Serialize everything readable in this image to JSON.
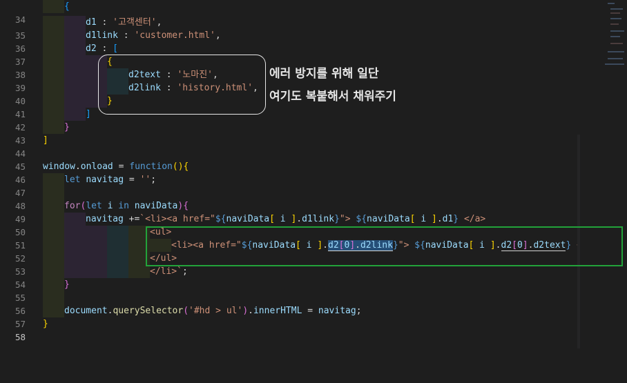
{
  "editor": {
    "line_numbers": [
      "34",
      "35",
      "36",
      "37",
      "38",
      "39",
      "40",
      "41",
      "42",
      "43",
      "44",
      "45",
      "46",
      "47",
      "48",
      "49",
      "50",
      "51",
      "52",
      "53",
      "54",
      "55",
      "56",
      "57",
      "58"
    ],
    "active_line": "58",
    "code": {
      "l35_d1_key": "d1",
      "l35_d1_val": "'고객센터'",
      "l36_d1link_key": "d1link",
      "l36_d1link_val": "'customer.html'",
      "l37_d2_key": "d2",
      "l39_d2text_key": "d2text",
      "l39_d2text_val": "'노마진'",
      "l40_d2link_key": "d2link",
      "l40_d2link_val": "'history.html'",
      "l46_window": "window",
      "l46_onload": "onload",
      "l46_function": "function",
      "l47_let": "let",
      "l47_navitag": "navitag",
      "l47_val": "''",
      "l49_for": "for",
      "l49_let": "let",
      "l49_i": "i",
      "l49_in": "in",
      "l49_navidata": "naviData",
      "l50_navitag": "navitag",
      "l57_document": "document",
      "l57_qs": "querySelector",
      "l57_arg": "'#hd > ul'",
      "l57_inner": "innerHTML",
      "l57_navitag": "navitag"
    }
  },
  "annotation": {
    "line1": "에러 방지를 위해 일단",
    "line2": "여기도 복붙해서 채워주기"
  },
  "colors": {
    "background": "#1e1e1e",
    "keyword": "#569cd6",
    "control": "#c586c0",
    "variable": "#9cdcfe",
    "function": "#dcdcaa",
    "string": "#ce9178",
    "highlight_box": "#22a33a"
  }
}
